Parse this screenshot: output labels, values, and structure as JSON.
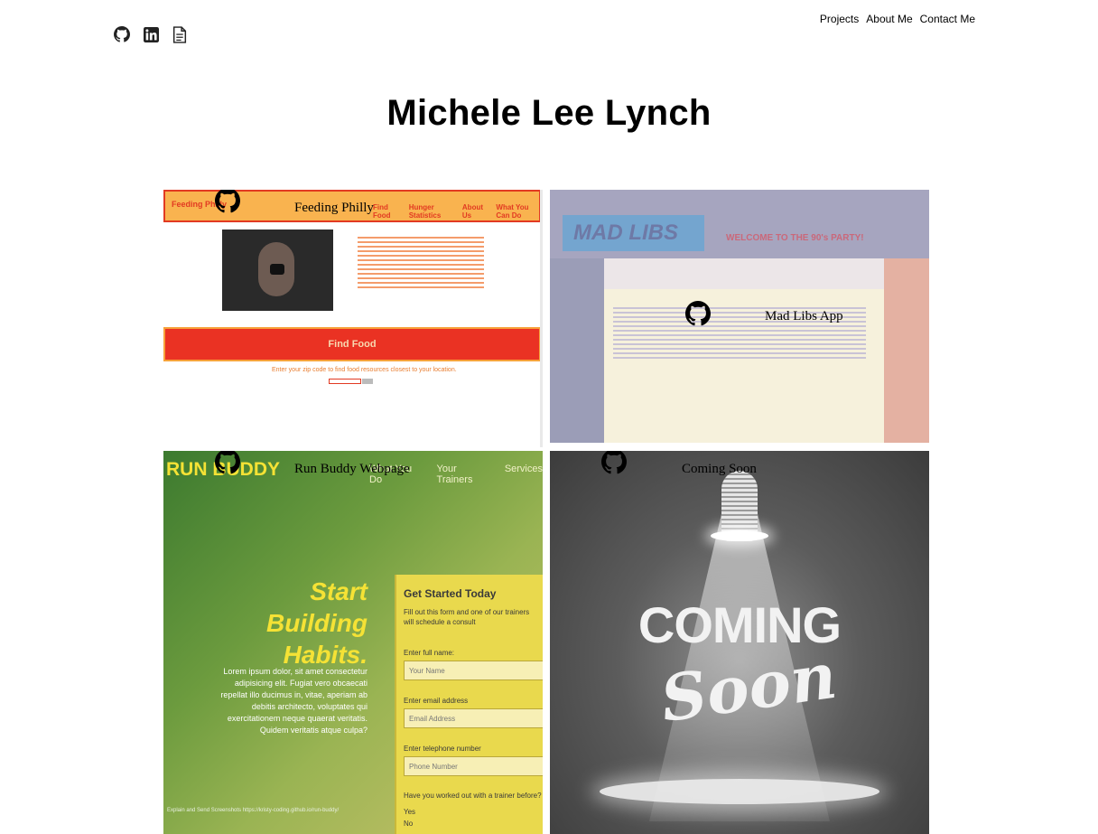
{
  "header": {
    "social_icons": [
      {
        "name": "github-icon"
      },
      {
        "name": "linkedin-icon"
      },
      {
        "name": "resume-icon"
      }
    ],
    "nav": {
      "projects": "Projects",
      "about": "About Me",
      "contact": "Contact Me"
    },
    "title": "Michele Lee Lynch"
  },
  "projects": [
    {
      "label": "Feeding Philly",
      "screenshot": {
        "brand": "Feeding Philly",
        "menu": [
          "Find Food",
          "Hunger Statistics",
          "About Us",
          "What You Can Do"
        ],
        "button": "Find Food",
        "tagline": "Enter your zip code to find food resources closest to your location."
      }
    },
    {
      "label": "Mad Libs App",
      "screenshot": {
        "title": "MAD LIBS",
        "subtitle": "WELCOME TO THE 90's PARTY!"
      }
    },
    {
      "label": "Run Buddy Webpage",
      "screenshot": {
        "brand": "RUN BUDDY",
        "menu": [
          "What You Do",
          "Your Trainers",
          "Services"
        ],
        "headline": "Start Building Habits.",
        "body": "Lorem ipsum dolor, sit amet consectetur adipisicing elit. Fugiat vero obcaecati repellat illo ducimus in, vitae, aperiam ab debitis architecto, voluptates qui exercitationem neque quaerat veritatis. Quidem veritatis atque culpa?",
        "form_title": "Get Started Today",
        "form_intro": "Fill out this form and one of our trainers will schedule a consult",
        "fields": [
          {
            "label": "Enter full name:",
            "placeholder": "Your Name"
          },
          {
            "label": "Enter email address",
            "placeholder": "Email Address"
          },
          {
            "label": "Enter telephone number",
            "placeholder": "Phone Number"
          }
        ],
        "question": "Have you worked out with a trainer before?",
        "answers": [
          "Yes",
          "No"
        ],
        "footer": "Explain and Send Screenshots https://kristy-coding.github.io/run-buddy/"
      }
    },
    {
      "label": "Coming Soon",
      "screenshot": {
        "line1": "COMING",
        "line2": "Soon"
      }
    }
  ]
}
